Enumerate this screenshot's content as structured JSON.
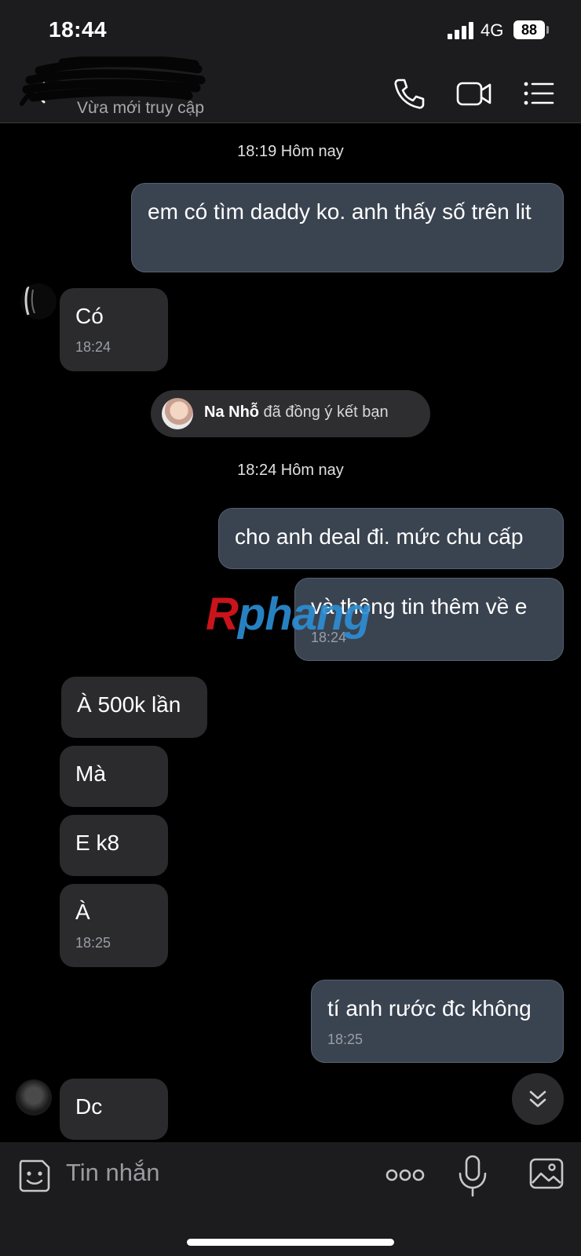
{
  "status_bar": {
    "time": "18:44",
    "network": "4G",
    "battery": "88"
  },
  "header": {
    "contact_name": "",
    "contact_status": "Vừa mới truy cập",
    "icons": [
      "back-icon",
      "phone-icon",
      "video-call-icon",
      "menu-icon"
    ]
  },
  "chat": {
    "time_separators": [
      "18:19 Hôm nay",
      "18:24 Hôm nay"
    ],
    "messages": [
      {
        "dir": "out",
        "text": "em có tìm daddy ko. anh thấy số trên lit",
        "time": ""
      },
      {
        "dir": "in",
        "text": "Có",
        "time": "18:24"
      },
      {
        "dir": "out",
        "text": "cho anh deal đi. mức chu cấp",
        "time": ""
      },
      {
        "dir": "out",
        "text": "và thông tin thêm về e",
        "time": "18:24"
      },
      {
        "dir": "in",
        "text": "À 500k lần",
        "time": ""
      },
      {
        "dir": "in",
        "text": "Mà",
        "time": ""
      },
      {
        "dir": "in",
        "text": "E k8",
        "time": ""
      },
      {
        "dir": "in",
        "text": "À",
        "time": "18:25"
      },
      {
        "dir": "out",
        "text": "tí anh rước đc không",
        "time": "18:25"
      },
      {
        "dir": "in",
        "text": "Dc",
        "time": ""
      }
    ],
    "friend_notice": {
      "name": "Na Nhỗ",
      "text": " đã đồng ý kết bạn"
    },
    "watermark": {
      "first": "R",
      "rest": "phang"
    }
  },
  "input_bar": {
    "placeholder": "Tin nhắn",
    "icons": [
      "sticker-icon",
      "more-icon",
      "microphone-icon",
      "image-icon"
    ]
  },
  "colors": {
    "background": "#000000",
    "bar": "#1c1c1e",
    "outgoing_bubble": "#3a4350",
    "incoming_bubble": "#2b2b2e"
  }
}
